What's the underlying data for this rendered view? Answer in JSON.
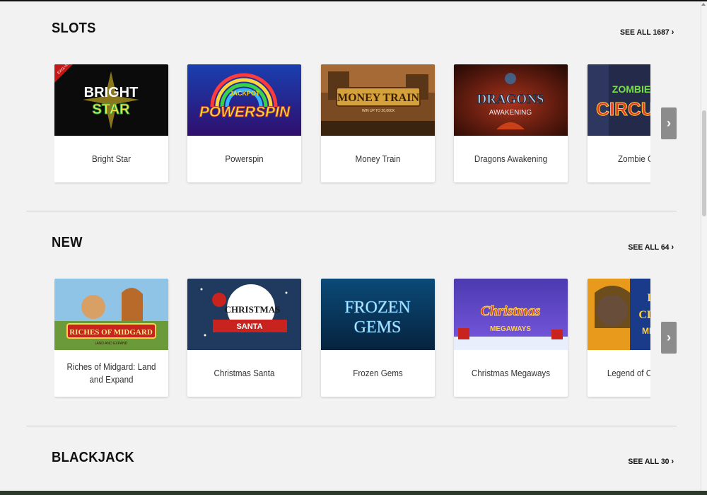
{
  "sections": [
    {
      "title": "SLOTS",
      "see_all": "SEE ALL 1687",
      "games": [
        {
          "name": "Bright Star",
          "thumb_text": "BRIGHT STAR",
          "badge": "EXCLUSIVE"
        },
        {
          "name": "Powerspin",
          "thumb_text": "POWERSPIN",
          "sub_text": "JACKPOT"
        },
        {
          "name": "Money Train",
          "thumb_text": "MONEY TRAIN",
          "sub_text": "WIN UP TO 20,000X"
        },
        {
          "name": "Dragons Awakening",
          "thumb_text": "DRAGONS",
          "sub_text": "AWAKENING"
        },
        {
          "name": "Zombie Circus",
          "thumb_text": "ZOMBIE CIRCUS"
        }
      ]
    },
    {
      "title": "NEW",
      "see_all": "SEE ALL 64",
      "games": [
        {
          "name": "Riches of Midgard: Land and Expand",
          "thumb_text": "RICHES OF MIDGARD",
          "sub_text": "LAND AND EXPAND"
        },
        {
          "name": "Christmas Santa",
          "thumb_text": "CHRISTMAS",
          "sub_text": "SANTA"
        },
        {
          "name": "Frozen Gems",
          "thumb_text": "FROZEN",
          "sub_text": "GEMS"
        },
        {
          "name": "Christmas Megaways",
          "thumb_text": "Christmas",
          "sub_text": "MEGAWAYS"
        },
        {
          "name": "Legend of Cleopatra",
          "thumb_text": "LEGEND OF CLEOPATRA",
          "sub_text": "MEGAWAYS"
        }
      ]
    },
    {
      "title": "BLACKJACK",
      "see_all": "SEE ALL 30",
      "games": []
    }
  ],
  "icons": {
    "see_all_chevron": "chevron-right-icon",
    "carousel_next": "chevron-right-icon"
  },
  "colors": {
    "page_bg": "#f2f2f2",
    "card_bg": "#ffffff",
    "next_button": "#8c8c8c",
    "divider": "#cfcfcf"
  }
}
